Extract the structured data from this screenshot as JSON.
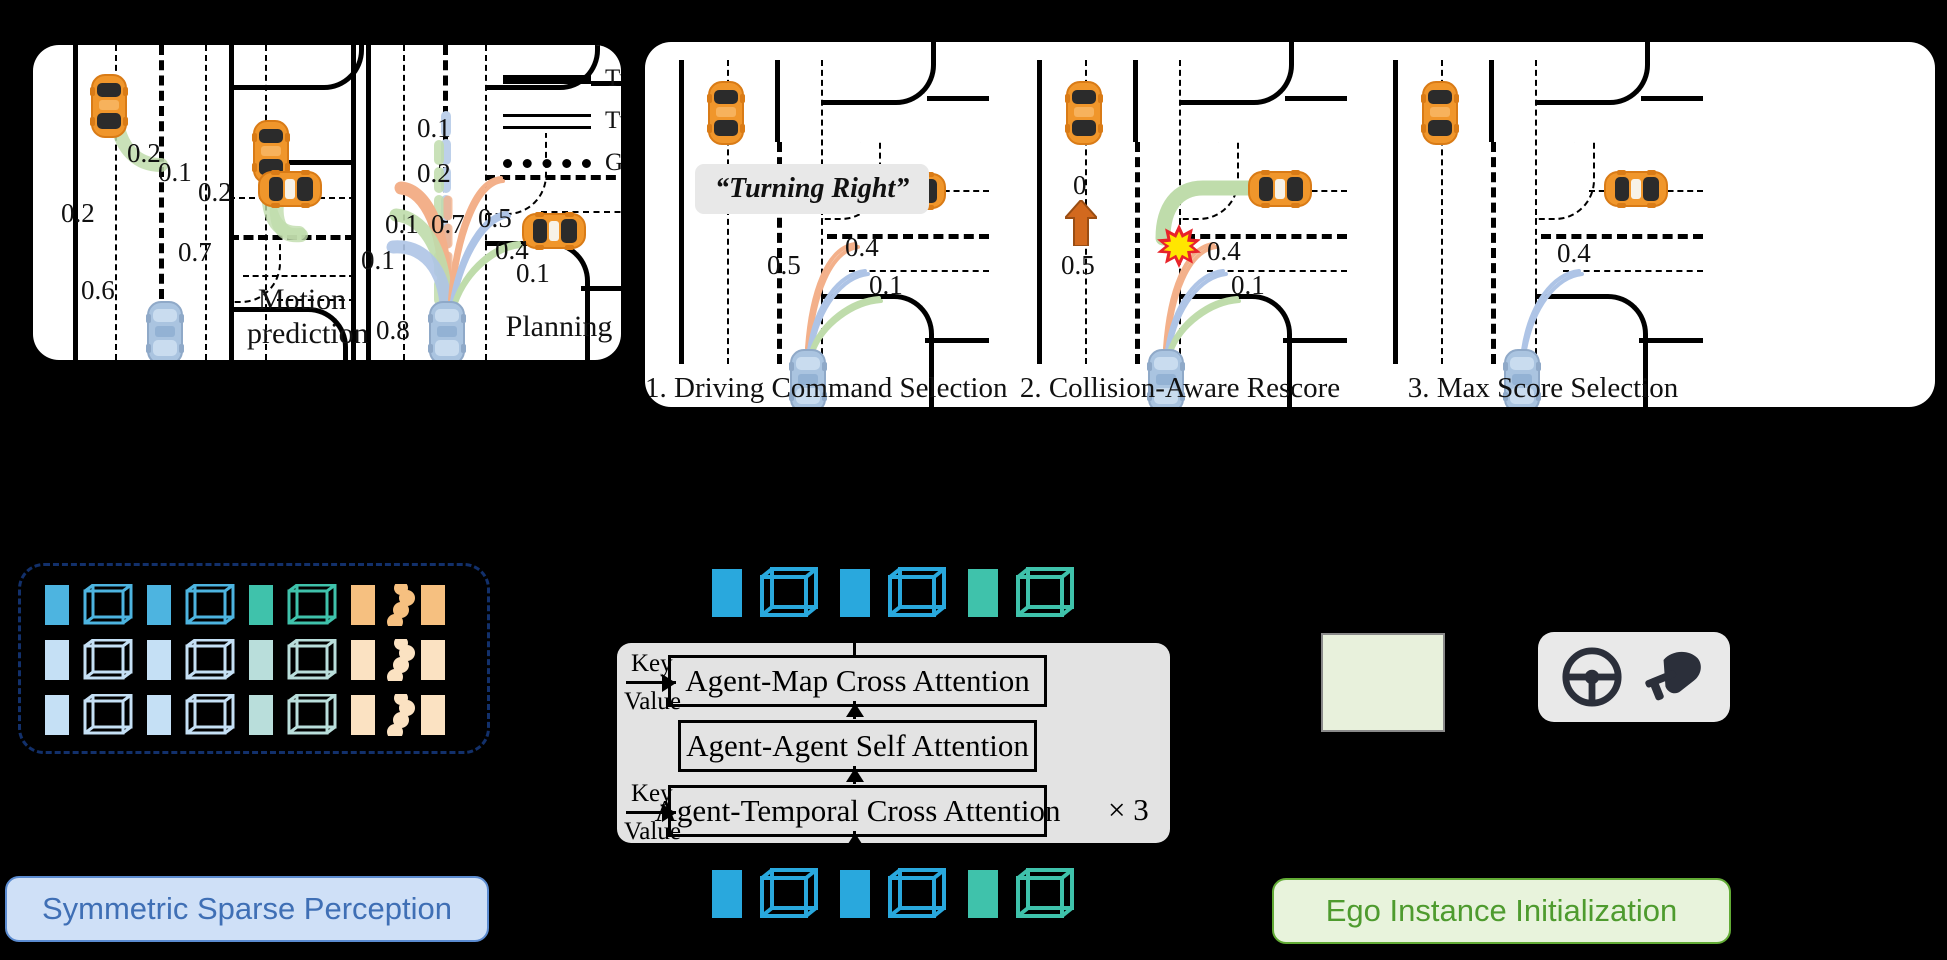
{
  "figure": {
    "title_hidden": "",
    "panels": {
      "left": {
        "name": "Motion prediction and Planning",
        "legend": [
          {
            "style": "solid",
            "label": "Turn left",
            "icon": "solid-line-icon"
          },
          {
            "style": "double",
            "label": "Turn right",
            "icon": "double-line-icon"
          },
          {
            "style": "dotted",
            "label": "Go straight",
            "icon": "dotted-line-icon"
          }
        ],
        "section_labels": {
          "motion": "Motion\nprediction",
          "motion_line1": "Motion",
          "motion_line2": "prediction",
          "planning": "Planning"
        },
        "scores": {
          "agent_a": [
            "0.2",
            "0.2",
            "0.6"
          ],
          "agent_b": [
            "0.1",
            "0.2",
            "0.7"
          ],
          "ego": [
            "0.1",
            "0.2",
            "0.1",
            "0.7",
            "0.5",
            "0.4",
            "0.1",
            "0.1",
            "0.8"
          ]
        }
      },
      "right": {
        "steps": [
          {
            "index": "1",
            "caption": "1. Driving Command Selection",
            "command_bubble": "“Turning Right”",
            "scores": [
              "0.5",
              "0.4",
              "0.1"
            ]
          },
          {
            "index": "2",
            "caption": "2. Collision-Aware Rescore",
            "rescore_from": "0.5",
            "rescore_to": "0",
            "scores": [
              "0.4",
              "0.1"
            ],
            "collision_icon": "collision-burst-icon"
          },
          {
            "index": "3",
            "caption": "3. Max Score Selection",
            "scores": [
              "0.4"
            ]
          }
        ]
      }
    },
    "bottom": {
      "perception_box": {
        "label": "Symmetric Sparse Perception",
        "token_groups": [
          {
            "kind": "feature-cube",
            "color": "#4db4e0",
            "rows": [
              "#4db4e0",
              "#c5e0f5",
              "#c5e0f5"
            ]
          },
          {
            "kind": "feature-cube",
            "color": "#4db4e0",
            "rows": [
              "#4db4e0",
              "#c5e0f5",
              "#c5e0f5"
            ]
          },
          {
            "kind": "feature-cube",
            "color": "#3fc2ab",
            "rows": [
              "#3fc2ab",
              "#b9dedb",
              "#b9dedb"
            ]
          },
          {
            "kind": "feature-poly",
            "color": "#f6c080",
            "rows": [
              "#f6c080",
              "#fbe2c2",
              "#fbe2c2"
            ]
          },
          {
            "kind": "feature-poly",
            "color": "#f6c080",
            "rows": [
              "#f6c080",
              "#fbe2c2",
              "#fbe2c2"
            ]
          }
        ]
      },
      "attention_block": {
        "rows": [
          {
            "label": "Agent-Map Cross Attention",
            "key": "Key",
            "value": "Value"
          },
          {
            "label": "Agent-Agent Self Attention",
            "key": "",
            "value": ""
          },
          {
            "label": "Agent-Temporal Cross Attention",
            "key": "Key",
            "value": "Value"
          }
        ],
        "repeat": "× 3"
      },
      "ego_block": {
        "label": "Ego Instance Initialization",
        "icons": [
          "steering-wheel-icon",
          "pedal-foot-icon"
        ]
      },
      "top_tokens": [
        {
          "color": "#4db4e0"
        },
        {
          "color": "#4db4e0"
        },
        {
          "color": "#3fc2ab"
        }
      ],
      "bottom_tokens": [
        {
          "color": "#29a8dd"
        },
        {
          "color": "#29a8dd"
        },
        {
          "color": "#3fc2ab"
        }
      ]
    },
    "colors": {
      "blue_token": "#4db4e0",
      "teal_token": "#3fc2ab",
      "orange_token": "#f6c080",
      "perception_pill_bg": "#cfe0f7",
      "perception_pill_text": "#3f6fb5",
      "ego_pill_bg": "#e8f3dc",
      "ego_pill_text": "#4e9b2e",
      "traj_green": "#b8dba4",
      "traj_orange": "#f4c0a0",
      "traj_blue": "#b8c9e8",
      "collision_red": "#e8232a",
      "collision_yellow": "#ffe600"
    }
  }
}
